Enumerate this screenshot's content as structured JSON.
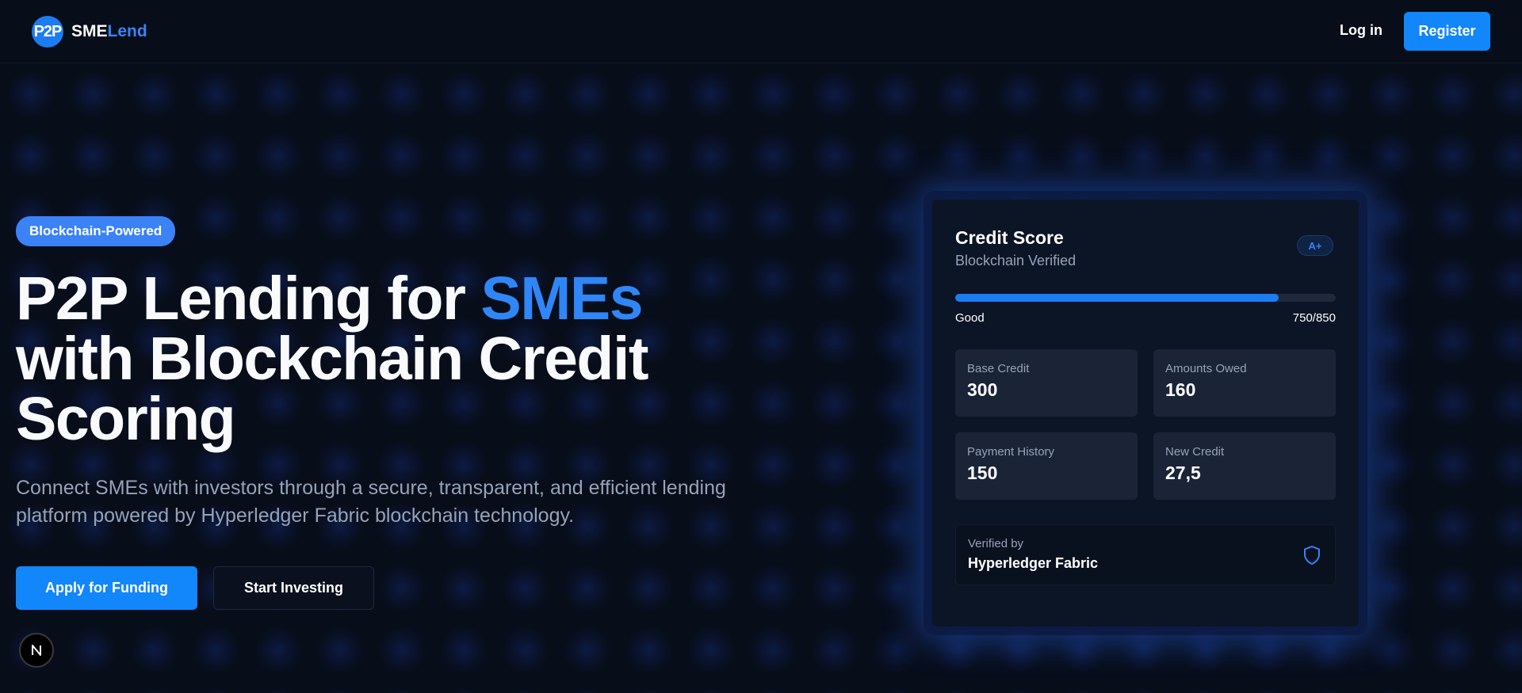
{
  "header": {
    "logo_badge": "P2P",
    "logo_part1": "SME",
    "logo_part2": "Lend",
    "login_label": "Log in",
    "register_label": "Register"
  },
  "hero": {
    "pill": "Blockchain-Powered",
    "title_part1": "P2P Lending for ",
    "title_accent": "SMEs",
    "title_part2": "with Blockchain Credit Scoring",
    "subtitle": "Connect SMEs with investors through a secure, transparent, and efficient lending platform powered by Hyperledger Fabric blockchain technology.",
    "apply_label": "Apply for Funding",
    "invest_label": "Start Investing"
  },
  "dev_badge": "N",
  "card": {
    "title": "Credit Score",
    "subtitle": "Blockchain Verified",
    "grade": "A+",
    "score_label": "Good",
    "score_text": "750/850",
    "score_fraction": 0.85,
    "metrics": [
      {
        "label": "Base Credit",
        "value": "300"
      },
      {
        "label": "Amounts Owed",
        "value": "160"
      },
      {
        "label": "Payment History",
        "value": "150"
      },
      {
        "label": "New Credit",
        "value": "27,5"
      }
    ],
    "verified_label": "Verified by",
    "verified_value": "Hyperledger Fabric"
  },
  "colors": {
    "background": "#080d1a",
    "accent": "#1286fb",
    "card": "#0c1526",
    "muted_text": "#94a3b8"
  },
  "icons": {
    "verified": "shield-icon"
  }
}
